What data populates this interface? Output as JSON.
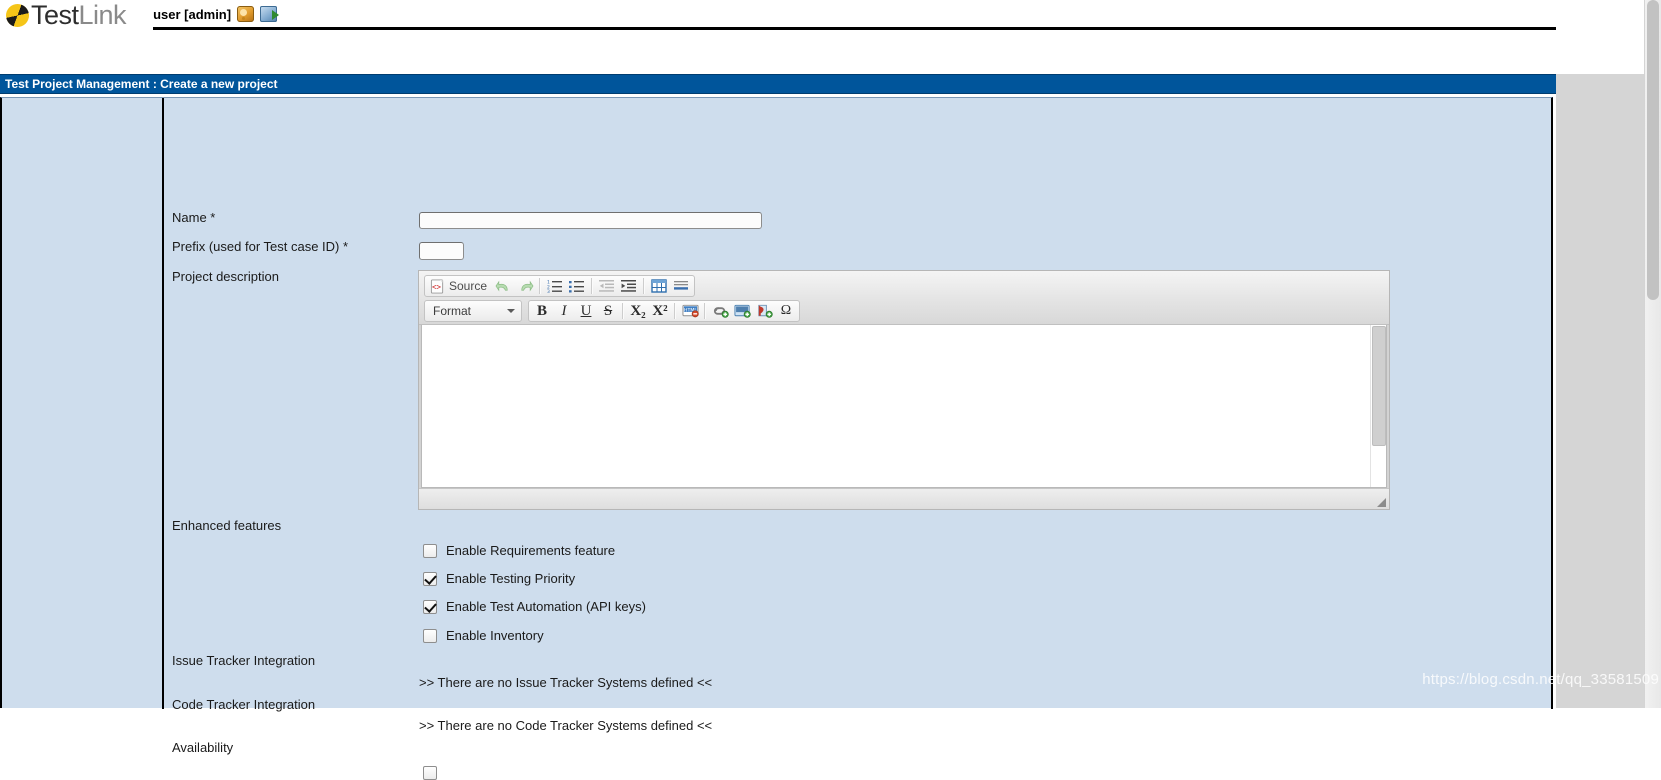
{
  "app": {
    "brand_bold": "Test",
    "brand_light": "Link",
    "logo_icon": "testlink-ball-icon"
  },
  "header": {
    "user_label": "user [admin]",
    "personal_icon": "personal-settings-icon",
    "logout_icon": "logout-icon"
  },
  "title_bar": {
    "text": "Test Project Management : Create a new project"
  },
  "form": {
    "name": {
      "label": "Name *",
      "value": "",
      "placeholder": ""
    },
    "prefix": {
      "label": "Prefix (used for Test case ID) *",
      "value": "",
      "placeholder": ""
    },
    "description": {
      "label": "Project description",
      "value": ""
    },
    "enhanced_features": {
      "label": "Enhanced features",
      "checkboxes": [
        {
          "label": "Enable Requirements feature",
          "checked": false
        },
        {
          "label": "Enable Testing Priority",
          "checked": true
        },
        {
          "label": "Enable Test Automation (API keys)",
          "checked": true
        },
        {
          "label": "Enable Inventory",
          "checked": false
        }
      ]
    },
    "issue_tracker": {
      "label": "Issue Tracker Integration",
      "note": ">> There are no Issue Tracker Systems defined <<"
    },
    "code_tracker": {
      "label": "Code Tracker Integration",
      "note": ">> There are no Code Tracker Systems defined <<"
    },
    "availability": {
      "label": "Availability"
    }
  },
  "editor": {
    "toolbar_row1": [
      {
        "name": "source-button",
        "label": "Source",
        "icon": "source-code-icon",
        "disabled": false
      },
      {
        "name": "undo-button",
        "label": "",
        "icon": "undo-icon",
        "disabled": true
      },
      {
        "name": "redo-button",
        "label": "",
        "icon": "redo-icon",
        "disabled": true
      },
      {
        "name": "numbered-list-button",
        "label": "",
        "icon": "numbered-list-icon",
        "disabled": false
      },
      {
        "name": "bulleted-list-button",
        "label": "",
        "icon": "bulleted-list-icon",
        "disabled": false
      },
      {
        "name": "outdent-button",
        "label": "",
        "icon": "outdent-icon",
        "disabled": true
      },
      {
        "name": "indent-button",
        "label": "",
        "icon": "indent-icon",
        "disabled": false
      },
      {
        "name": "table-button",
        "label": "",
        "icon": "table-icon",
        "disabled": false
      },
      {
        "name": "horizontal-rule-button",
        "label": "",
        "icon": "horizontal-rule-icon",
        "disabled": false
      }
    ],
    "format_select": {
      "label": "Format",
      "caret_icon": "chevron-down-icon"
    },
    "toolbar_row2": [
      {
        "name": "bold-button",
        "label": "B",
        "icon": "bold-icon"
      },
      {
        "name": "italic-button",
        "label": "I",
        "icon": "italic-icon"
      },
      {
        "name": "underline-button",
        "label": "U",
        "icon": "underline-icon"
      },
      {
        "name": "strikethrough-button",
        "label": "S",
        "icon": "strikethrough-icon"
      },
      {
        "name": "subscript-button",
        "label": "X₂",
        "icon": "subscript-icon"
      },
      {
        "name": "superscript-button",
        "label": "X²",
        "icon": "superscript-icon"
      },
      {
        "name": "remove-format-button",
        "label": "",
        "icon": "remove-html-format-icon"
      },
      {
        "name": "link-button",
        "label": "",
        "icon": "link-icon"
      },
      {
        "name": "image-button",
        "label": "",
        "icon": "image-icon"
      },
      {
        "name": "flash-button",
        "label": "",
        "icon": "flash-icon"
      },
      {
        "name": "special-char-button",
        "label": "Ω",
        "icon": "omega-special-character-icon"
      }
    ],
    "resize_handle": "resize-grip-icon"
  },
  "watermark": {
    "text": "https://blog.csdn.net/qq_33581509"
  },
  "colors": {
    "title_bar": "#00559b",
    "panel_bg": "#cedded",
    "accent": "#00559b"
  }
}
